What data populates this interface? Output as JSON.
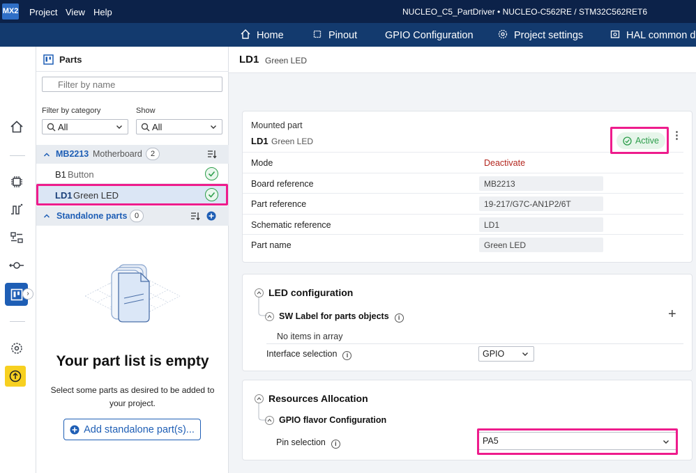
{
  "app": {
    "logo": "MX2",
    "menu": [
      "Project",
      "View",
      "Help"
    ],
    "project_title": "NUCLEO_C5_PartDriver  •  NUCLEO-C562RE / STM32C562RET6"
  },
  "nav": {
    "home": "Home",
    "pinout": "Pinout",
    "gpio": "GPIO Configuration",
    "settings": "Project settings",
    "hal": "HAL common de"
  },
  "parts": {
    "title": "Parts",
    "filter_placeholder": "Filter by name",
    "filter_category_label": "Filter by category",
    "filter_category_value": "All",
    "show_label": "Show",
    "show_value": "All",
    "group": {
      "name": "MB2213",
      "type": "Motherboard",
      "count": "2"
    },
    "items": [
      {
        "id": "B1",
        "name": "Button"
      },
      {
        "id": "LD1",
        "name": "Green LED"
      }
    ],
    "standalone": {
      "label": "Standalone parts",
      "count": "0"
    },
    "empty_title": "Your part list is empty",
    "empty_desc": "Select some parts as desired to be added to your project.",
    "add_button": "Add standalone part(s)..."
  },
  "detail": {
    "id": "LD1",
    "name": "Green LED",
    "mounted_label": "Mounted part",
    "status": "Active",
    "status_color": "#2e9e4c",
    "highlight_color": "#ee1c8c",
    "rows": [
      {
        "key": "Mode",
        "value": "Deactivate"
      },
      {
        "key": "Board reference",
        "value": "MB2213"
      },
      {
        "key": "Part reference",
        "value": "19-217/G7C-AN1P2/6T"
      },
      {
        "key": "Schematic reference",
        "value": "LD1"
      },
      {
        "key": "Part name",
        "value": "Green LED"
      }
    ]
  },
  "led_config": {
    "title": "LED configuration",
    "sw_label": "SW Label for parts objects",
    "no_items": "No items in array",
    "interface_label": "Interface selection",
    "interface_value": "GPIO"
  },
  "resources": {
    "title": "Resources Allocation",
    "gpio_flavor": "GPIO flavor Configuration",
    "pin_label": "Pin selection",
    "pin_value": "PA5"
  }
}
